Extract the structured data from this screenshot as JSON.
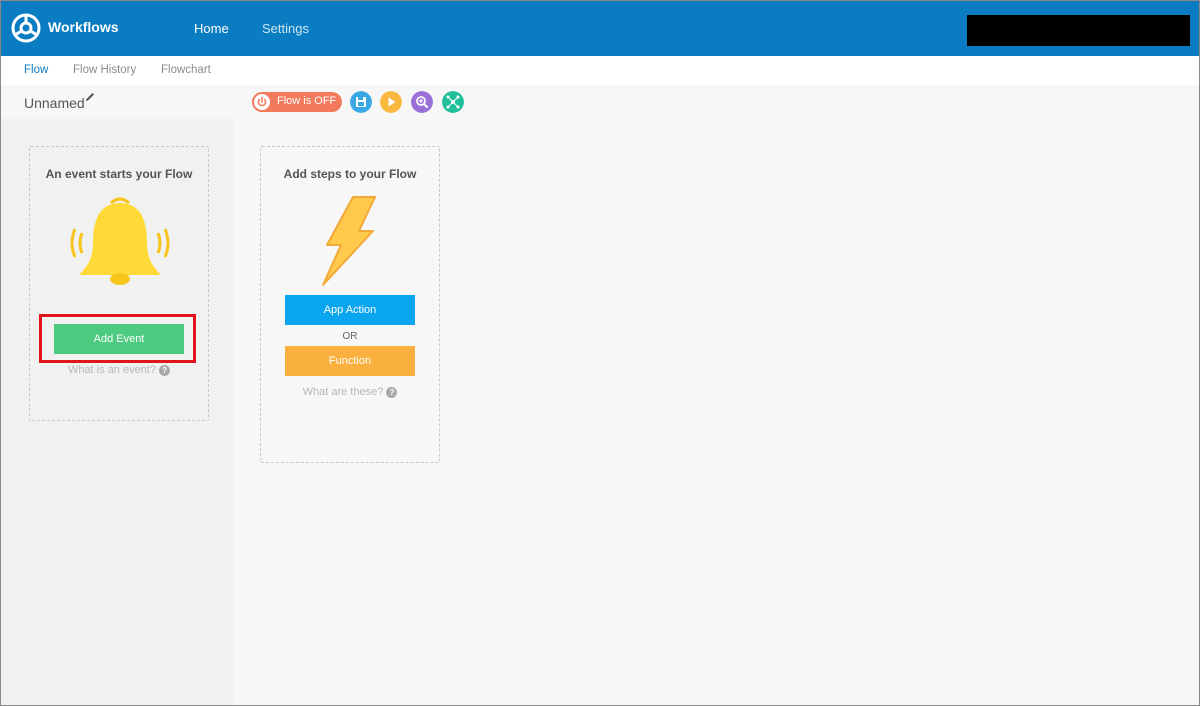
{
  "header": {
    "app_title": "Workflows",
    "nav": {
      "home": "Home",
      "settings": "Settings"
    }
  },
  "subnav": {
    "tabs": [
      "Flow",
      "Flow History",
      "Flowchart"
    ],
    "active": "Flow"
  },
  "flow": {
    "name": "Unnamed"
  },
  "toolbar": {
    "toggle_label": "Flow is OFF",
    "icons": [
      "save-icon",
      "play-icon",
      "zoom-icon",
      "share-icon"
    ]
  },
  "event_card": {
    "title": "An event starts your Flow",
    "button": "Add Event",
    "help_text": "What is an event?",
    "help_mark": "?"
  },
  "steps_card": {
    "title": "Add steps to your Flow",
    "button_app_action": "App Action",
    "or_label": "OR",
    "button_function": "Function",
    "help_text": "What are these?",
    "help_mark": "?"
  },
  "colors": {
    "header": "#0a7cc2",
    "toggle_off": "#f37a5d",
    "add_event": "#4ccb80",
    "app_action": "#09a5ee",
    "function": "#f9b03e",
    "highlight": "#e3131b"
  }
}
